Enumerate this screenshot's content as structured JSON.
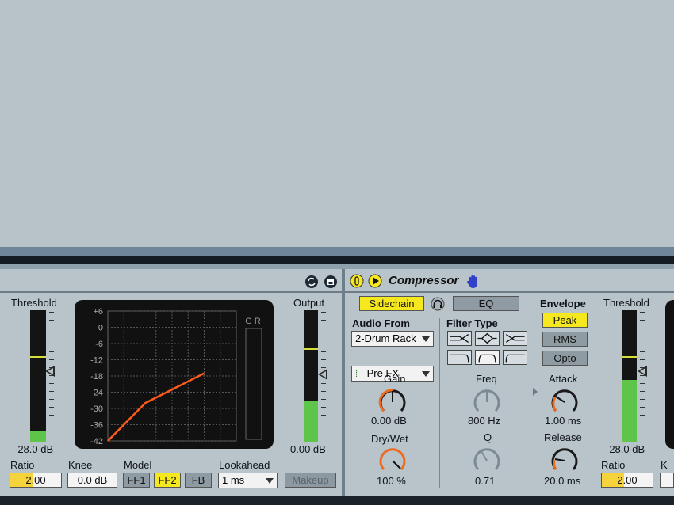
{
  "left_device": {
    "threshold_label": "Threshold",
    "threshold_value": "-28.0 dB",
    "output_label": "Output",
    "output_value": "0.00 dB",
    "gr_label": "G R",
    "graph_ticks": [
      "+6",
      "0",
      "-6",
      "-12",
      "-18",
      "-24",
      "-30",
      "-36",
      "-42"
    ],
    "ratio_label": "Ratio",
    "ratio_value": "2.00",
    "knee_label": "Knee",
    "knee_value": "0.0 dB",
    "model_label": "Model",
    "model_options": [
      "FF1",
      "FF2",
      "FB"
    ],
    "model_selected": "FF2",
    "lookahead_label": "Lookahead",
    "lookahead_value": "1 ms",
    "makeup_label": "Makeup"
  },
  "right_device": {
    "title": "Compressor",
    "sidechain_label": "Sidechain",
    "eq_label": "EQ",
    "audio_from_label": "Audio From",
    "audio_from_value": "2-Drum Rack",
    "audio_from_tap": "- Pre FX",
    "filter_type_label": "Filter Type",
    "gain_label": "Gain",
    "gain_value": "0.00 dB",
    "drywet_label": "Dry/Wet",
    "drywet_value": "100 %",
    "freq_label": "Freq",
    "freq_value": "800 Hz",
    "q_label": "Q",
    "q_value": "0.71",
    "envelope_label": "Envelope",
    "envelope_options": [
      "Peak",
      "RMS",
      "Opto"
    ],
    "envelope_selected": "Peak",
    "attack_label": "Attack",
    "attack_value": "1.00 ms",
    "release_label": "Release",
    "release_value": "20.0 ms",
    "threshold_label": "Threshold",
    "threshold_value": "-28.0 dB",
    "ratio_label": "Ratio",
    "ratio_value": "2.00",
    "knee_label_partial": "K"
  },
  "colors": {
    "accent_yellow": "#f6e81e",
    "meter_green": "#5fc44a",
    "knob_orange": "#f06a1a",
    "curve_orange": "#ff5a1a"
  }
}
